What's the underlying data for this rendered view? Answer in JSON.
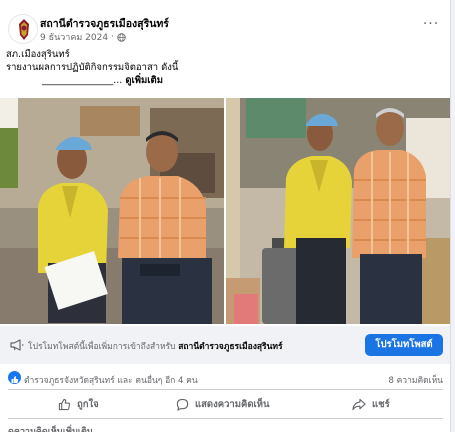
{
  "post": {
    "page_name": "สถานีตำรวจภูธรเมืองสุรินทร์",
    "date": "9 ธันวาคม 2024",
    "privacy_icon": "globe-icon",
    "more_icon": "more-options-icon",
    "text_line1": "สภ.เมืองสุรินทร์",
    "text_line2": "รายงานผลการปฏิบัติกิจกรรมจิตอาสา ดังนี้",
    "text_line3": "_______________...",
    "see_more": "ดูเพิ่มเติม"
  },
  "promotion": {
    "icon": "megaphone-icon",
    "text": "โปรโมทโพสต์นี้เพื่อเพิ่มการเข้าถึงสำหรับ",
    "page_name": "สถานีตำรวจภูธรเมืองสุรินทร์",
    "button_label": "โปรโมทโพสต์"
  },
  "reactions": {
    "icon": "like-reaction-icon",
    "summary": "ตำรวจภูธรจังหวัดสุรินทร์ และ คนอื่นๆ อีก 4 คน",
    "comment_count": "8 ความคิดเห็น"
  },
  "actions": {
    "like_label": "ถูกใจ",
    "comment_label": "แสดงความคิดเห็น",
    "share_label": "แชร์"
  },
  "footer": {
    "more_comments": "ดูความคิดเห็นเพิ่มเติม"
  },
  "colors": {
    "accent": "#1b74e4",
    "uniform_yellow": "#e8d635",
    "shirt_orange": "#e9a06b",
    "cap_blue": "#6aa8d8"
  }
}
